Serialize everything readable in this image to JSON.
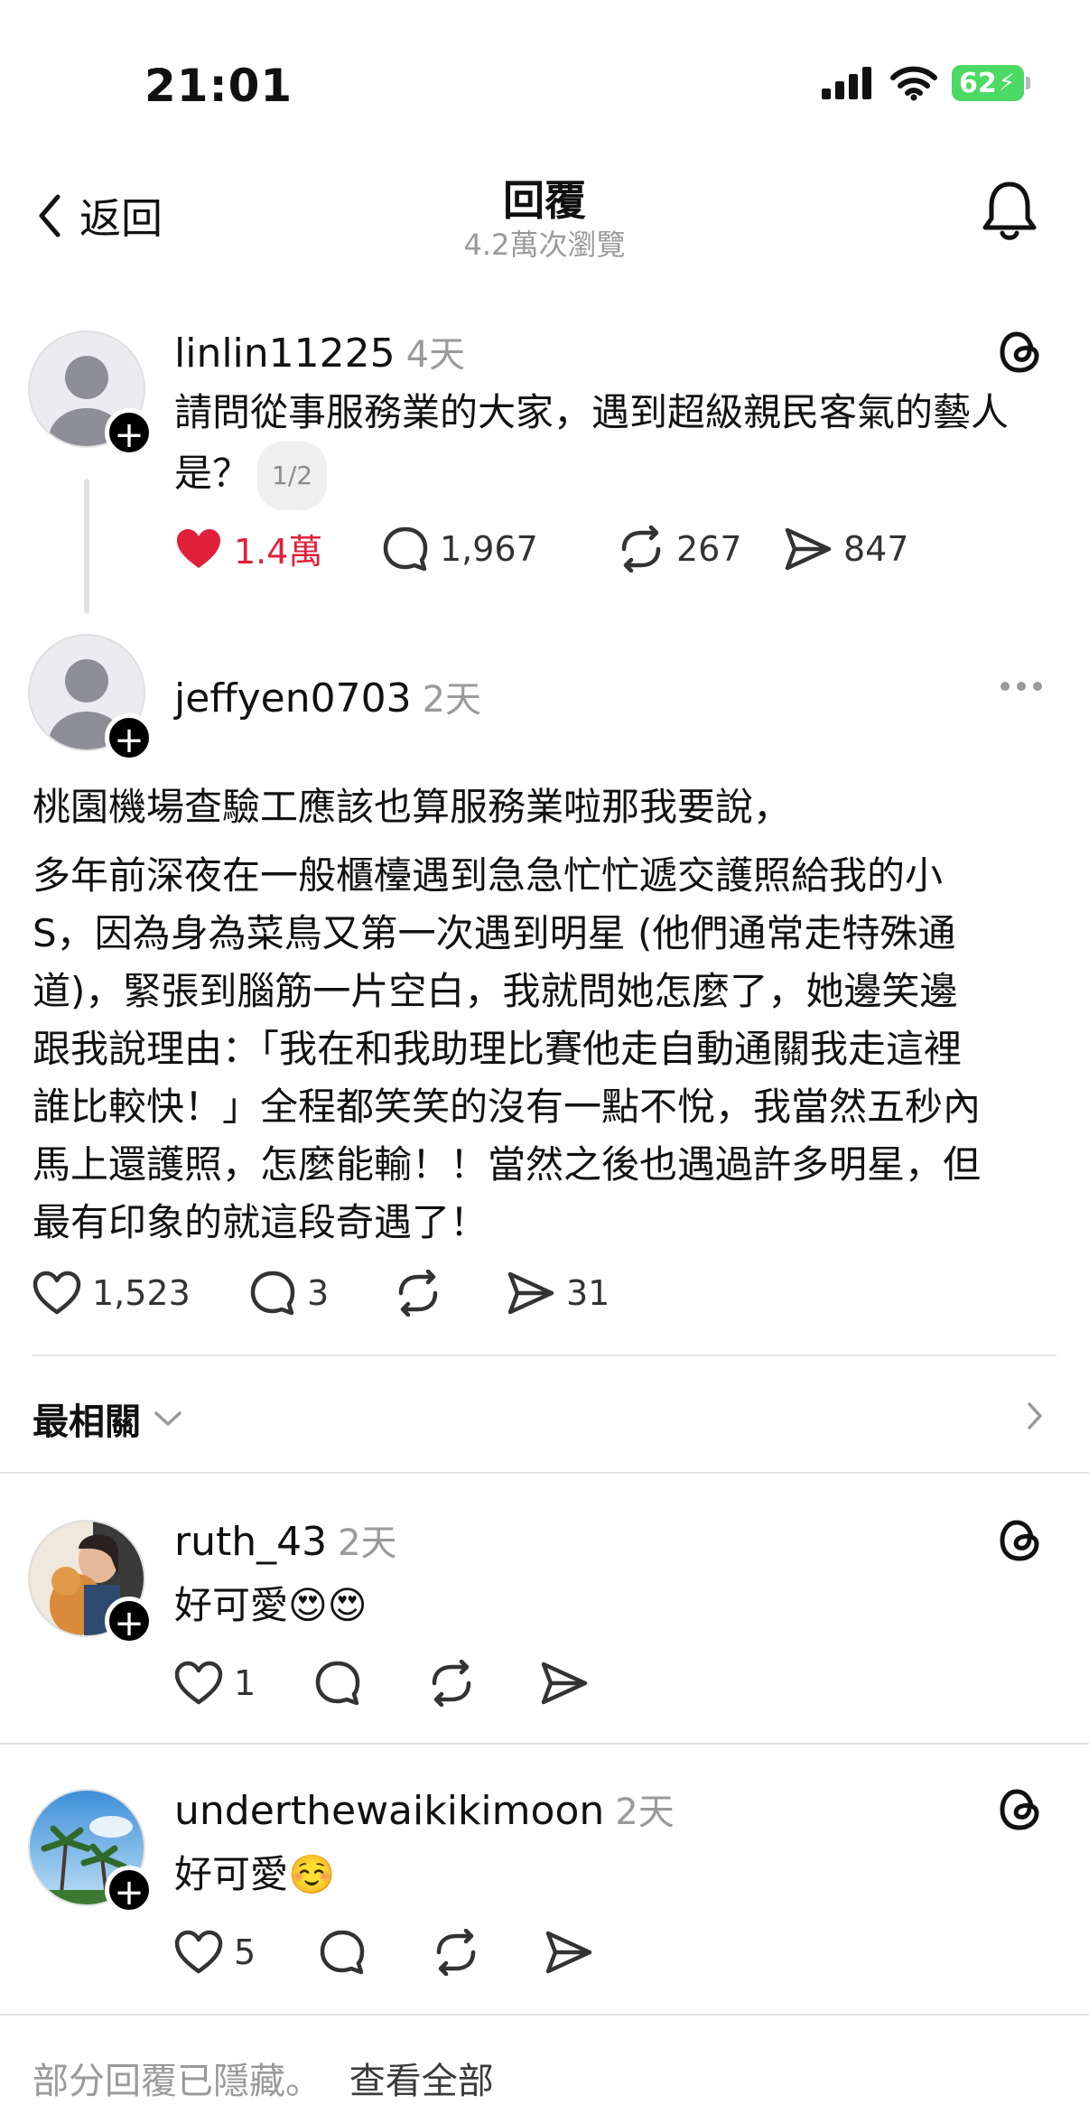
{
  "status_bar": {
    "time": "21:01",
    "battery": "62"
  },
  "nav": {
    "back_label": "返回",
    "title": "回覆",
    "views": "4.2萬次瀏覽"
  },
  "original_post": {
    "username": "linlin11225",
    "time": "4天",
    "text": "請問從事服務業的大家，遇到超級親民客氣的藝人是？",
    "page_indicator": "1/2",
    "likes": "1.4萬",
    "comments": "1,967",
    "reposts": "267",
    "shares": "847",
    "liked_color": "#e0203a"
  },
  "reply": {
    "username": "jeffyen0703",
    "time": "2天",
    "lines": [
      "桃園機場查驗工應該也算服務業啦那我要說，",
      "多年前深夜在一般櫃檯遇到急急忙忙遞交護照給我的小",
      "S，因為身為菜鳥又第一次遇到明星 (他們通常走特殊通",
      "道)，緊張到腦筋一片空白，我就問她怎麼了，她邊笑邊",
      "跟我說理由：「我在和我助理比賽他走自動通關我走這裡",
      "誰比較快！」全程都笑笑的沒有一點不悅，我當然五秒內",
      "馬上還護照，怎麼能輸！！當然之後也遇過許多明星，但",
      "最有印象的就這段奇遇了！"
    ],
    "likes": "1,523",
    "comments": "3",
    "shares": "31"
  },
  "sort": {
    "label": "最相關"
  },
  "comments": [
    {
      "username": "ruth_43",
      "time": "2天",
      "text": "好可愛😍😍",
      "likes": "1"
    },
    {
      "username": "underthewaikikimoon",
      "time": "2天",
      "text": "好可愛☺️",
      "likes": "5"
    }
  ],
  "footer": {
    "hidden_text": "部分回覆已隱藏。",
    "view_all": "查看全部"
  }
}
